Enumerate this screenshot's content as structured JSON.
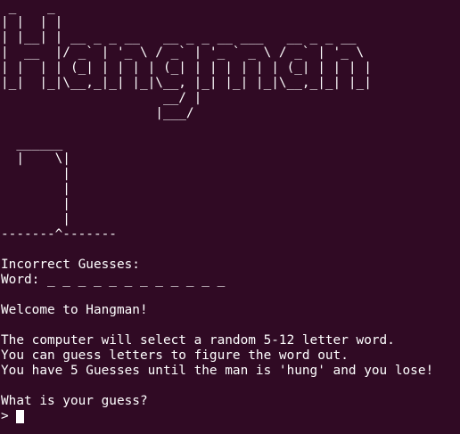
{
  "terminal": {
    "banner": [
      " _    _",
      "| |  | |",
      "| |__| | __ _ _ __   __ _ _ __ ___   __ _ _ __",
      "|  __  |/ _` | '_ \\ / _` | '_ ` _ \\ / _` | '_ \\",
      "| |  | | (_| | | | | (_| | | | | | | (_| | | | |",
      "|_|  |_|\\__,_|_| |_|\\__, |_| |_| |_|\\__,_|_| |_|",
      "                     __/ |",
      "                    |___/"
    ],
    "blank_a": "",
    "gallows": [
      "  ______",
      "  |    \\|",
      "        |",
      "        |",
      "        |",
      "        |",
      "-------^-------"
    ],
    "blank_b": "",
    "incorrect_guesses": "Incorrect Guesses:",
    "word_line": "Word: _ _ _ _ _ _ _ _ _ _ _ _",
    "blank_c": "",
    "welcome": "Welcome to Hangman!",
    "blank_d": "",
    "rules": [
      "The computer will select a random 5-12 letter word.",
      "You can guess letters to figure the word out.",
      "You have 5 Guesses until the man is 'hung' and you lose!"
    ],
    "blank_e": "",
    "question": "What is your guess?",
    "prompt_symbol": ">"
  },
  "colors": {
    "background": "#300a24",
    "foreground": "#ffffff"
  }
}
